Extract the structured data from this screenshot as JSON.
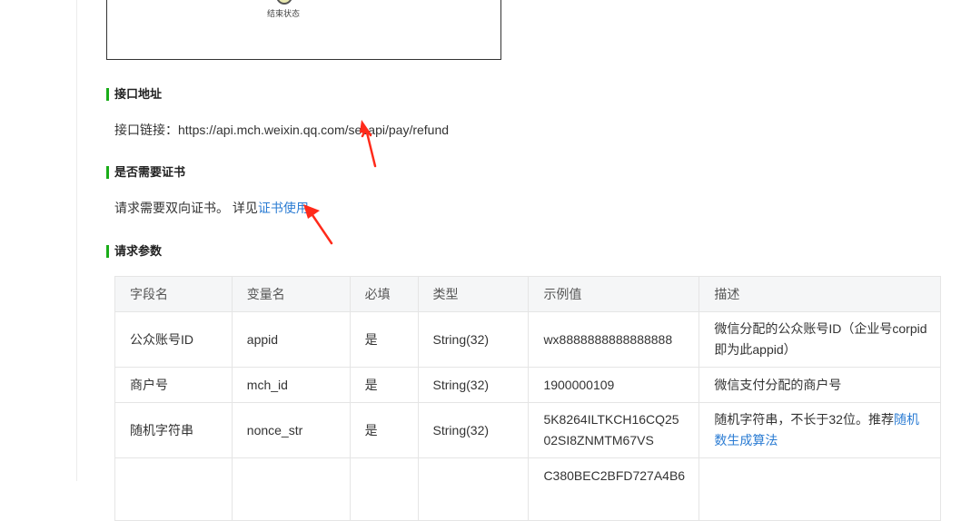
{
  "diagram": {
    "end_state_label": "结束状态"
  },
  "sections": {
    "api_url": {
      "title": "接口地址",
      "label": "接口链接：",
      "url": "https://api.mch.weixin.qq.com/secapi/pay/refund"
    },
    "cert": {
      "title": "是否需要证书",
      "text": "请求需要双向证书。 详见",
      "link_text": "证书使用"
    },
    "params": {
      "title": "请求参数"
    }
  },
  "table": {
    "headers": [
      "字段名",
      "变量名",
      "必填",
      "类型",
      "示例值",
      "描述"
    ],
    "rows": [
      {
        "field": "公众账号ID",
        "var": "appid",
        "required": "是",
        "type": "String(32)",
        "example": "wx8888888888888888",
        "desc": "微信分配的公众账号ID（企业号corpid即为此appid）",
        "desc_link": ""
      },
      {
        "field": "商户号",
        "var": "mch_id",
        "required": "是",
        "type": "String(32)",
        "example": "1900000109",
        "desc": "微信支付分配的商户号",
        "desc_link": ""
      },
      {
        "field": "随机字符串",
        "var": "nonce_str",
        "required": "是",
        "type": "String(32)",
        "example": "5K8264ILTKCH16CQ2502SI8ZNMTM67VS",
        "desc": "随机字符串，不长于32位。推荐",
        "desc_link": "随机数生成算法"
      },
      {
        "field": "",
        "var": "",
        "required": "",
        "type": "",
        "example": "C380BEC2BFD727A4B6",
        "desc": "",
        "desc_link": ""
      }
    ]
  },
  "colors": {
    "accent_bar": "#1aad19",
    "link": "#2b7cd3",
    "annotation_arrow": "#ff2a1a"
  }
}
